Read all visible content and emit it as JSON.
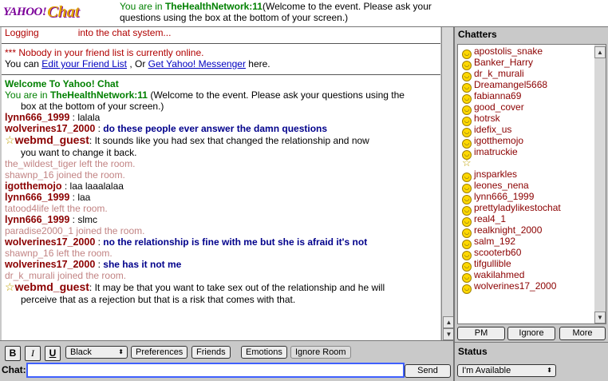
{
  "header": {
    "logo_yahoo": "YAHOO!",
    "logo_chat": "Chat",
    "room_prefix": "You are in ",
    "room_name": "TheHealthNetwork:11",
    "room_desc": "(Welcome to the event. Please ask your questions using the box at the bottom of your screen.)"
  },
  "chat": {
    "logging_a": "Logging",
    "logging_b": "into the chat system...",
    "nobody_stars": "***",
    "nobody_text": " Nobody in your friend list is currently online.",
    "can_a": "You can ",
    "edit_link": "Edit your Friend List",
    "can_b": " , Or ",
    "get_link": "Get Yahoo! Messenger",
    "can_c": "  here.",
    "welcome": "Welcome To Yahoo! Chat",
    "room_prefix": "You are in ",
    "room_name": "TheHealthNetwork:11",
    "room_desc_1": " (Welcome to the event. Please ask your questions using the",
    "room_desc_2": "box at the bottom of your screen.)",
    "lines": [
      {
        "nick": "lynn666_1999",
        "sep": " : ",
        "text": "lalala"
      },
      {
        "nick": "wolverines17_2000",
        "sep": " : ",
        "text": "do these people ever answer the damn questions"
      },
      {
        "nick": "webmd_guest",
        "sep": ": ",
        "text": "It sounds like you had sex that changed the relationship and now",
        "text2": "you want to change it back."
      },
      {
        "nick": "the_wildest_tiger",
        "text": "  left the room."
      },
      {
        "nick": "shawnp_16",
        "text": " joined the room."
      },
      {
        "nick": "igotthemojo",
        "sep": " : ",
        "text": "laa laaalalaa"
      },
      {
        "nick": "lynn666_1999",
        "sep": " : ",
        "text": "laa"
      },
      {
        "nick": "tatood4life",
        "text": "  left the room."
      },
      {
        "nick": "lynn666_1999",
        "sep": " : ",
        "text": "slmc"
      },
      {
        "nick": "paradise2000_1",
        "text": " joined the room."
      },
      {
        "nick": "wolverines17_2000",
        "sep": " : ",
        "text": "no the relationship is fine with me but she is afraid it's not"
      },
      {
        "nick": "shawnp_16",
        "text": "  left the room."
      },
      {
        "nick": "wolverines17_2000",
        "sep": " : ",
        "text": "she has it not me"
      },
      {
        "nick": "dr_k_murali",
        "text": " joined the room."
      },
      {
        "nick": "webmd_guest",
        "sep": ": ",
        "text": "It may be that you want to take sex out of the relationship and he will",
        "text2": "perceive that as a rejection but that is a risk that comes with that."
      }
    ]
  },
  "chatters": {
    "title": "Chatters",
    "names": [
      "apostolis_snake",
      "Banker_Harry",
      "dr_k_murali",
      "Dreamangel5668",
      "fabianna69",
      "good_cover",
      "hotrsk",
      "idefix_us",
      "igotthemojo",
      "imatruckie",
      "",
      "jnsparkles",
      "leones_nena",
      "lynn666_1999",
      "prettyladylikestochat",
      "real4_1",
      "realknight_2000",
      "salm_192",
      "scooterb60",
      "tifgullible",
      "wakilahmed",
      "wolverines17_2000"
    ],
    "pm": "PM",
    "ignore": "Ignore",
    "more": "More"
  },
  "toolbar": {
    "bold": "B",
    "italic": "I",
    "underline": "U",
    "color_select": "Black",
    "preferences": "Preferences",
    "friends": "Friends",
    "emotions": "Emotions",
    "ignore_room": "Ignore Room",
    "chat_label": "Chat:",
    "chat_input": "",
    "send": "Send"
  },
  "status": {
    "title": "Status",
    "value": "I'm Available"
  },
  "colors": {
    "nick": "#8b0000",
    "welcome_green": "#008000",
    "link_blue": "#0000c0",
    "accent_purple": "#7b0099"
  }
}
